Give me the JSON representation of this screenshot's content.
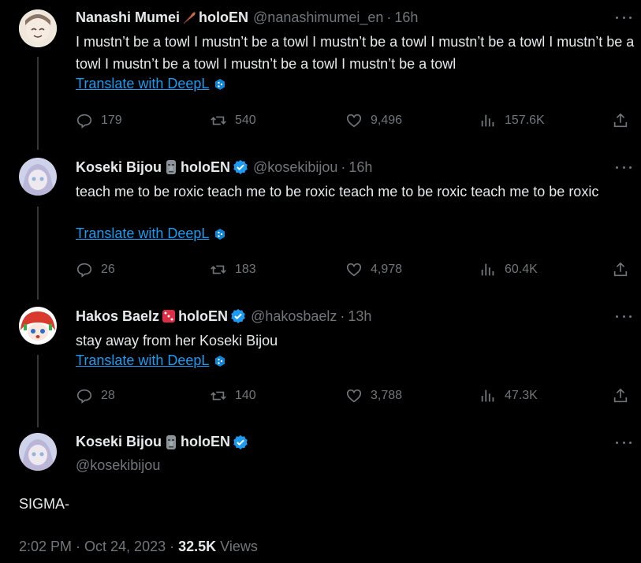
{
  "tweets": [
    {
      "name": "Nanashi Mumei",
      "emoji": "feather-icon",
      "suffix": "holoEN",
      "handle": "@nanashimumei_en",
      "time": "16h",
      "verified": false,
      "text": "I mustn’t be a towl I mustn’t be a towl I mustn’t be a towl I mustn’t be a towl I mustn’t be a towl I mustn’t be a towl I mustn’t be a towl I mustn’t be a towl",
      "translate": "Translate with DeepL",
      "replies": "179",
      "reposts": "540",
      "likes": "9,496",
      "views": "157.6K"
    },
    {
      "name": "Koseki Bijou",
      "emoji": "moai-icon",
      "suffix": "holoEN",
      "handle": "@kosekibijou",
      "time": "16h",
      "verified": true,
      "text": "teach me to be roxic teach me to be roxic teach me to be roxic teach me to be roxic",
      "translate": "Translate with DeepL",
      "replies": "26",
      "reposts": "183",
      "likes": "4,978",
      "views": "60.4K"
    },
    {
      "name": "Hakos Baelz",
      "emoji": "dice-icon",
      "suffix": "holoEN",
      "handle": "@hakosbaelz",
      "time": "13h",
      "verified": true,
      "text": "stay away from her Koseki Bijou",
      "translate": "Translate with DeepL",
      "replies": "28",
      "reposts": "140",
      "likes": "3,788",
      "views": "47.3K"
    }
  ],
  "focus": {
    "name": "Koseki Bijou",
    "emoji": "moai-icon",
    "suffix": "holoEN",
    "handle": "@kosekibijou",
    "text": "SIGMA-",
    "timestamp": "2:02 PM · Oct 24, 2023 · ",
    "views_count": "32.5K",
    "views_label": " Views"
  },
  "colors": {
    "background": "#000000",
    "text": "#e7e9ea",
    "muted": "#71767b",
    "link": "#1d9bf0",
    "verified": "#1d9bf0"
  }
}
